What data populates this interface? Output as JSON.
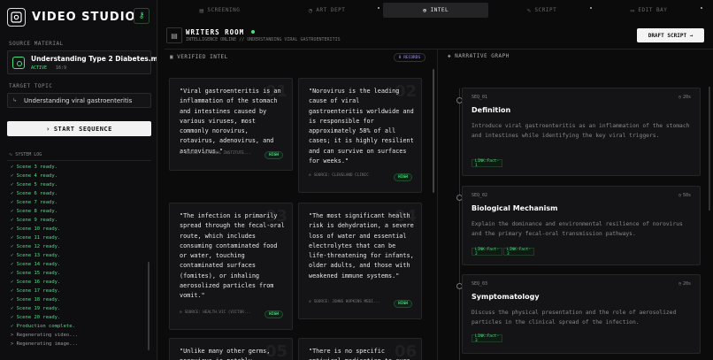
{
  "app": {
    "title": "VIDEO STUDIO"
  },
  "sidebar": {
    "source_label": "SOURCE MATERIAL",
    "source": {
      "title": "Understanding Type 2 Diabetes.mov",
      "status": "ACTIVE",
      "ratio": "16:9"
    },
    "topic_label": "TARGET TOPIC",
    "topic": "Understanding viral gastroenteritis",
    "start_label": "START SEQUENCE",
    "log_label": "SYSTEM LOG",
    "log": [
      "✓ Scene 3 ready.",
      "✓ Scene 4 ready.",
      "✓ Scene 5 ready.",
      "✓ Scene 6 ready.",
      "✓ Scene 7 ready.",
      "✓ Scene 8 ready.",
      "✓ Scene 9 ready.",
      "✓ Scene 10 ready.",
      "✓ Scene 11 ready.",
      "✓ Scene 12 ready.",
      "✓ Scene 13 ready.",
      "✓ Scene 14 ready.",
      "✓ Scene 15 ready.",
      "✓ Scene 16 ready.",
      "✓ Scene 17 ready.",
      "✓ Scene 18 ready.",
      "✓ Scene 19 ready.",
      "✓ Scene 20 ready.",
      "✓ Production complete.",
      "> Regenerating video...",
      "> Regenerating image..."
    ]
  },
  "nav": {
    "tabs": [
      {
        "label": "SCREENING"
      },
      {
        "label": "ART DEPT"
      },
      {
        "label": "INTEL"
      },
      {
        "label": "SCRIPT"
      },
      {
        "label": "EDIT BAY"
      }
    ]
  },
  "header": {
    "title": "WRITERS ROOM",
    "subtitle": "INTELLIGENCE ONLINE // UNDERSTANDING VIRAL GASTROENTERITIS",
    "draft_label": "DRAFT SCRIPT →"
  },
  "intel": {
    "heading": "VERIFIED INTEL",
    "records_label": "8 RECORDS",
    "cards": [
      {
        "num": "01",
        "quote": "\"Viral gastroenteritis is an inflammation of the stomach and intestines caused by various viruses, most commonly norovirus, rotavirus, adenovirus, and astrovirus.\"",
        "source": "SOURCE: NATIONAL INSTITUTE...",
        "badge": "HIGH"
      },
      {
        "num": "02",
        "quote": "\"Norovirus is the leading cause of viral gastroenteritis worldwide and is responsible for approximately 58% of all cases; it is highly resilient and can survive on surfaces for weeks.\"",
        "source": "SOURCE: CLEVELAND CLINIC",
        "badge": "HIGH"
      },
      {
        "num": "03",
        "quote": "\"The infection is primarily spread through the fecal-oral route, which includes consuming contaminated food or water, touching contaminated surfaces (fomites), or inhaling aerosolized particles from vomit.\"",
        "source": "SOURCE: HEALTH.VIC (VICTOR...",
        "badge": "HIGH"
      },
      {
        "num": "04",
        "quote": "\"The most significant health risk is dehydration, a severe loss of water and essential electrolytes that can be life-threatening for infants, older adults, and those with weakened immune systems.\"",
        "source": "SOURCE: JOHNS HOPKINS MEDI...",
        "badge": "HIGH"
      },
      {
        "num": "05",
        "quote": "\"Unlike many other germs, norovirus is notably",
        "source": "",
        "badge": ""
      },
      {
        "num": "06",
        "quote": "\"There is no specific antiviral medication to cure",
        "source": "",
        "badge": ""
      }
    ]
  },
  "narrative": {
    "heading": "NARRATIVE GRAPH",
    "scenes": [
      {
        "id": "SEQ_01",
        "duration": "20s",
        "title": "Definition",
        "desc": "Introduce viral gastroenteritis as an inflammation of the stomach and intestines while identifying the key viral triggers.",
        "links": [
          "LINK:Fact-1"
        ]
      },
      {
        "id": "SEQ_02",
        "duration": "50s",
        "title": "Biological Mechanism",
        "desc": "Explain the dominance and environmental resilience of norovirus and the primary fecal-oral transmission pathways.",
        "links": [
          "LINK:Fact-2",
          "LINK:Fact-3"
        ]
      },
      {
        "id": "SEQ_03",
        "duration": "20s",
        "title": "Symptomatology",
        "desc": "Discuss the physical presentation and the role of aerosolized particles in the clinical spread of the infection.",
        "links": [
          "LINK:Fact-3"
        ]
      }
    ]
  }
}
